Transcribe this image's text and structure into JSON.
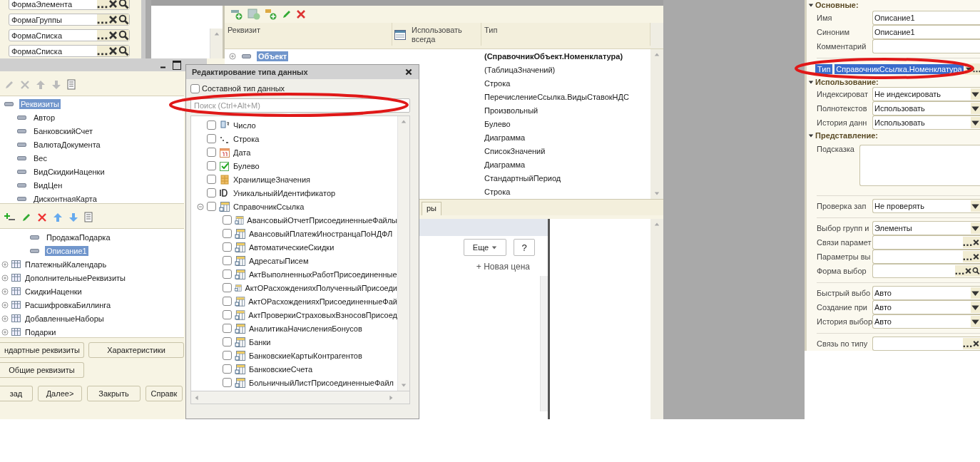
{
  "element_forms": [
    "ФормаЭлемента",
    "ФормаГруппы",
    "ФормаСписка",
    "ФормаСписка"
  ],
  "columns": [
    "Реквизит",
    "Использовать всегда",
    "Тип"
  ],
  "rows": [
    {
      "kind": "object",
      "name": "Объект",
      "selected": true,
      "type": "(СправочникОбъект.Номенклатура)"
    },
    {
      "kind": "attribute",
      "type": "(ТаблицаЗначений)"
    },
    {
      "kind": "attribute",
      "type": "Строка"
    },
    {
      "kind": "attribute",
      "type": "ПеречислениеСсылка.ВидыСтавокНДС"
    },
    {
      "kind": "attribute",
      "type": "Произвольный"
    },
    {
      "kind": "attribute",
      "type": "Булево"
    },
    {
      "kind": "attribute",
      "type": "Диаграмма"
    },
    {
      "kind": "attribute",
      "type": "СписокЗначений"
    },
    {
      "kind": "attribute",
      "type": "Диаграмма"
    },
    {
      "kind": "attribute",
      "type": "СтандартныйПериод"
    },
    {
      "kind": "attribute",
      "type": "Строка"
    }
  ],
  "tab_fragment": "ры",
  "form_preview": {
    "more_button": "Еще",
    "help_button": "?",
    "add_link": "+ Новая цена"
  },
  "object_editor": {
    "attributes": {
      "label": "Реквизиты",
      "selected": true,
      "children": [
        {
          "label": "Автор",
          "selected": false
        },
        {
          "label": "БанковскийСчет",
          "selected": false
        },
        {
          "label": "ВалютаДокумента",
          "selected": false
        },
        {
          "label": "Вес",
          "selected": false
        },
        {
          "label": "ВидСкидкиНаценки",
          "selected": false
        },
        {
          "label": "ВидЦен",
          "selected": false
        },
        {
          "label": "ДисконтнаяКарта",
          "selected": false
        }
      ]
    },
    "tabular": [
      {
        "kind": "attribute",
        "label": "ПродажаПодарка",
        "selected": false
      },
      {
        "kind": "attribute",
        "label": "Описание1",
        "selected": true
      },
      {
        "kind": "table",
        "label": "ПлатежныйКалендарь",
        "selected": false,
        "expanded": false
      },
      {
        "kind": "table",
        "label": "ДополнительныеРеквизиты",
        "selected": false,
        "expanded": false
      },
      {
        "kind": "table",
        "label": "СкидкиНаценки",
        "selected": false,
        "expanded": false
      },
      {
        "kind": "table",
        "label": "РасшифровкаБиллинга",
        "selected": false,
        "expanded": false
      },
      {
        "kind": "table",
        "label": "ДобавленныеНаборы",
        "selected": false,
        "expanded": false
      },
      {
        "kind": "table",
        "label": "Подарки",
        "selected": false,
        "expanded": false
      }
    ],
    "buttons": [
      [
        "ндартные реквизиты",
        "Характеристики"
      ],
      [
        "Общие реквизиты"
      ]
    ],
    "nav_buttons": [
      "зад",
      "Далее>",
      "Закрыть",
      "Справк"
    ]
  },
  "type_dialog": {
    "title": "Редактирование типа данных",
    "composite": {
      "label": "Составной тип данных",
      "checked": false
    },
    "search_placeholder": "Поиск (Ctrl+Alt+M)",
    "items": [
      {
        "kind": "number",
        "label": "Число",
        "checked": false
      },
      {
        "kind": "string",
        "label": "Строка",
        "checked": false
      },
      {
        "kind": "date",
        "label": "Дата",
        "checked": false
      },
      {
        "kind": "boolean",
        "label": "Булево",
        "checked": false
      },
      {
        "kind": "storage",
        "label": "ХранилищеЗначения",
        "checked": false
      },
      {
        "kind": "uuid",
        "label": "УникальныйИдентификатор",
        "checked": false
      },
      {
        "kind": "catalog",
        "label": "СправочникСсылка",
        "checked": false,
        "expanded": true,
        "children": [
          {
            "label": "АвансовыйОтчетПрисоединенныеФайлы",
            "checked": false
          },
          {
            "label": "АвансовыйПлатежИностранцаПоНДФЛ",
            "checked": false
          },
          {
            "label": "АвтоматическиеСкидки",
            "checked": false
          },
          {
            "label": "АдресатыПисем",
            "checked": false
          },
          {
            "label": "АктВыполненныхРаботПрисоединенные",
            "checked": false
          },
          {
            "label": "АктОРасхожденияхПолученныйПрисоеди",
            "checked": false
          },
          {
            "label": "АктОРасхожденияхПрисоединенныеФай",
            "checked": false
          },
          {
            "label": "АктПроверкиСтраховыхВзносовПрисоед",
            "checked": false
          },
          {
            "label": "АналитикаНачисленияБонусов",
            "checked": false
          },
          {
            "label": "Банки",
            "checked": false
          },
          {
            "label": "БанковскиеКартыКонтрагентов",
            "checked": false
          },
          {
            "label": "БанковскиеСчета",
            "checked": false
          },
          {
            "label": "БольничныйЛистПрисоединенныеФайл",
            "checked": false
          }
        ]
      }
    ]
  },
  "properties": [
    {
      "kind": "section",
      "title": "Основные:",
      "expanded": true
    },
    {
      "kind": "text",
      "label": "Имя",
      "value": "Описание1"
    },
    {
      "kind": "text",
      "label": "Синоним",
      "value": "Описание1"
    },
    {
      "kind": "text",
      "label": "Комментарий"
    },
    {
      "kind": "type",
      "label": "Тип",
      "value": "СправочникСсылка.Номенклатура",
      "divider": true
    },
    {
      "kind": "section",
      "title": "Использование:",
      "expanded": true
    },
    {
      "kind": "select",
      "label": "Индексироват",
      "value": "Не индексировать"
    },
    {
      "kind": "select",
      "label": "Полнотекстов",
      "value": "Использовать"
    },
    {
      "kind": "select",
      "label": "История данн",
      "value": "Использовать"
    },
    {
      "kind": "section",
      "title": "Представление:",
      "expanded": true
    },
    {
      "kind": "textarea",
      "label": "Подсказка"
    },
    {
      "kind": "select",
      "label": "Проверка зап",
      "value": "Не проверять",
      "divider": true
    },
    {
      "kind": "select",
      "label": "Выбор групп и",
      "value": "Элементы",
      "divider": true
    },
    {
      "kind": "choice",
      "label": "Связи парамет"
    },
    {
      "kind": "choice",
      "label": "Параметры вы"
    },
    {
      "kind": "choice_search",
      "label": "Форма выбор"
    },
    {
      "kind": "select",
      "label": "Быстрый выбо",
      "value": "Авто",
      "divider": true
    },
    {
      "kind": "select",
      "label": "Создание при",
      "value": "Авто"
    },
    {
      "kind": "select",
      "label": "История выбор",
      "value": "Авто"
    },
    {
      "kind": "choice",
      "label": "Связь по типу",
      "divider": true
    }
  ]
}
